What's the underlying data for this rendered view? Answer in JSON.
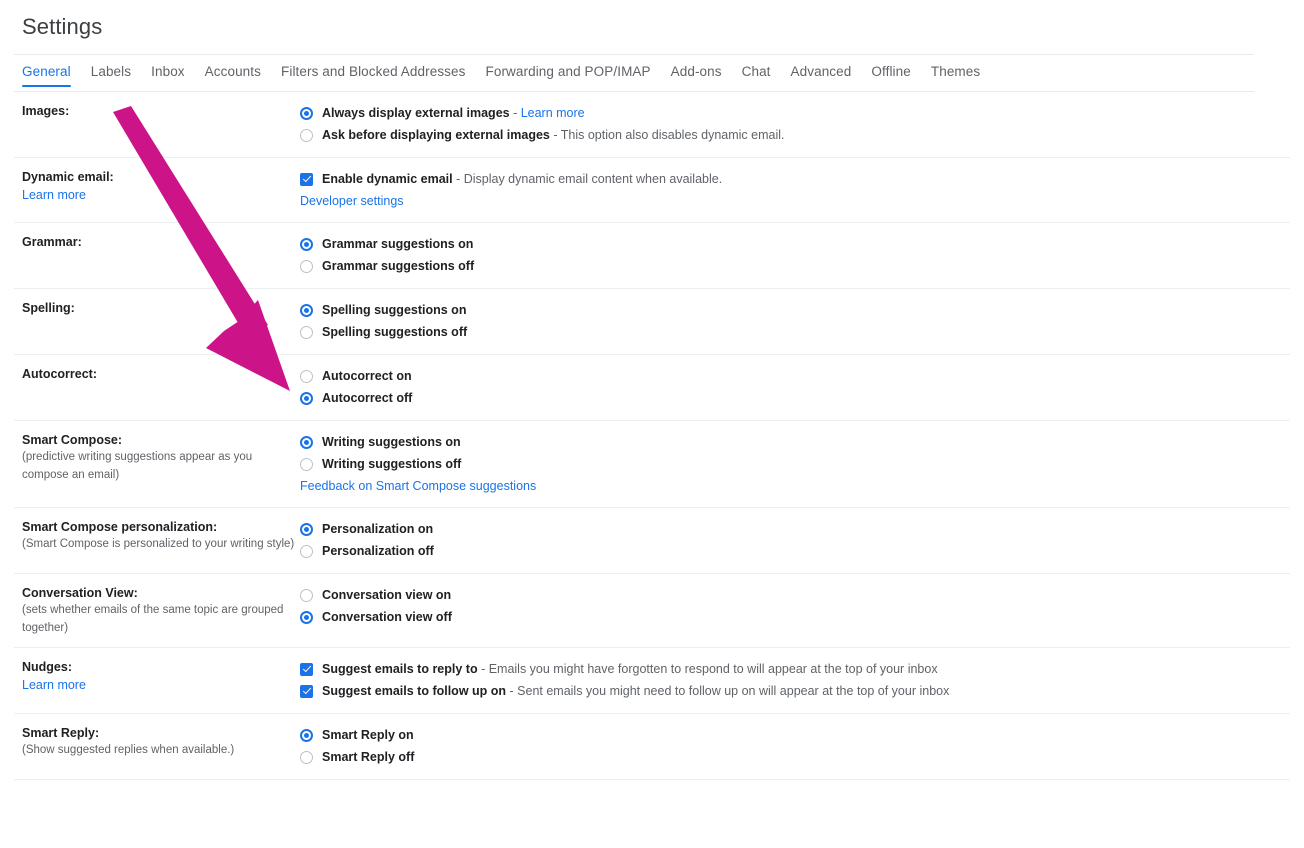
{
  "header": {
    "title": "Settings"
  },
  "tabs": [
    {
      "label": "General",
      "active": true
    },
    {
      "label": "Labels",
      "active": false
    },
    {
      "label": "Inbox",
      "active": false
    },
    {
      "label": "Accounts",
      "active": false
    },
    {
      "label": "Filters and Blocked Addresses",
      "active": false
    },
    {
      "label": "Forwarding and POP/IMAP",
      "active": false
    },
    {
      "label": "Add-ons",
      "active": false
    },
    {
      "label": "Chat",
      "active": false
    },
    {
      "label": "Advanced",
      "active": false
    },
    {
      "label": "Offline",
      "active": false
    },
    {
      "label": "Themes",
      "active": false
    }
  ],
  "settings": {
    "images": {
      "label": "Images:",
      "options": [
        {
          "strong": "Always display external images",
          "sep": " - ",
          "link": "Learn more",
          "selected": true
        },
        {
          "strong": "Ask before displaying external images",
          "sep": " - ",
          "rest": "This option also disables dynamic email.",
          "selected": false
        }
      ]
    },
    "dynamic_email": {
      "label": "Dynamic email:",
      "link": "Learn more",
      "checkbox": {
        "strong": "Enable dynamic email",
        "sep": " - ",
        "rest": "Display dynamic email content when available.",
        "checked": true
      },
      "sub_link": "Developer settings"
    },
    "grammar": {
      "label": "Grammar:",
      "options": [
        {
          "strong": "Grammar suggestions on",
          "selected": true
        },
        {
          "strong": "Grammar suggestions off",
          "selected": false
        }
      ]
    },
    "spelling": {
      "label": "Spelling:",
      "options": [
        {
          "strong": "Spelling suggestions on",
          "selected": true
        },
        {
          "strong": "Spelling suggestions off",
          "selected": false
        }
      ]
    },
    "autocorrect": {
      "label": "Autocorrect:",
      "options": [
        {
          "strong": "Autocorrect on",
          "selected": false
        },
        {
          "strong": "Autocorrect off",
          "selected": true
        }
      ]
    },
    "smart_compose": {
      "label": "Smart Compose:",
      "desc": "(predictive writing suggestions appear as you compose an email)",
      "options": [
        {
          "strong": "Writing suggestions on",
          "selected": true
        },
        {
          "strong": "Writing suggestions off",
          "selected": false
        }
      ],
      "sub_link": "Feedback on Smart Compose suggestions"
    },
    "smart_compose_personalization": {
      "label": "Smart Compose personalization:",
      "desc": "(Smart Compose is personalized to your writing style)",
      "options": [
        {
          "strong": "Personalization on",
          "selected": true
        },
        {
          "strong": "Personalization off",
          "selected": false
        }
      ]
    },
    "conversation_view": {
      "label": "Conversation View:",
      "desc": "(sets whether emails of the same topic are grouped together)",
      "options": [
        {
          "strong": "Conversation view on",
          "selected": false
        },
        {
          "strong": "Conversation view off",
          "selected": true
        }
      ]
    },
    "nudges": {
      "label": "Nudges:",
      "link": "Learn more",
      "checkboxes": [
        {
          "strong": "Suggest emails to reply to",
          "sep": " - ",
          "rest": "Emails you might have forgotten to respond to will appear at the top of your inbox",
          "checked": true
        },
        {
          "strong": "Suggest emails to follow up on",
          "sep": " - ",
          "rest": "Sent emails you might need to follow up on will appear at the top of your inbox",
          "checked": true
        }
      ]
    },
    "smart_reply": {
      "label": "Smart Reply:",
      "desc": "(Show suggested replies when available.)",
      "options": [
        {
          "strong": "Smart Reply on",
          "selected": true
        },
        {
          "strong": "Smart Reply off",
          "selected": false
        }
      ]
    }
  },
  "annotation": {
    "arrow_color": "#cc1488",
    "points_at": "autocorrect-off-radio"
  },
  "colors": {
    "accent": "#1a73e8",
    "text": "#202124",
    "muted": "#5f6368",
    "divider": "#eceff1",
    "annotation": "#cc1488"
  }
}
